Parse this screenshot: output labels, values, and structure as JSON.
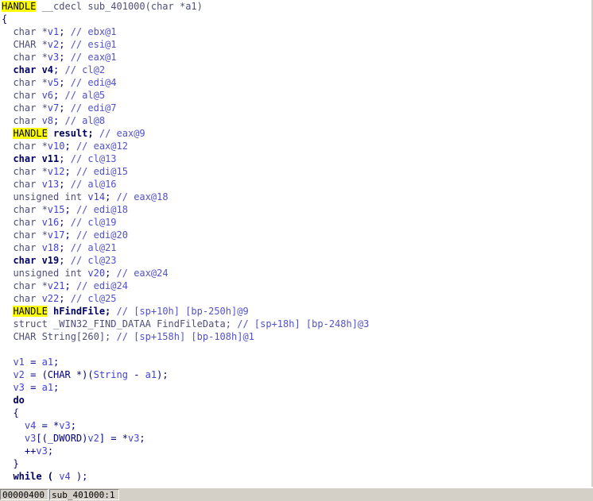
{
  "code_lines": [
    [
      [
        "HANDLE",
        "cursor"
      ],
      [
        " __cdecl sub_401000(char *a1)",
        "muted"
      ]
    ],
    [
      [
        "{",
        "default"
      ]
    ],
    [
      [
        "  char *",
        "muted"
      ],
      [
        "v1",
        "var"
      ],
      [
        "; ",
        "default"
      ],
      [
        "// ebx@1",
        "comment"
      ]
    ],
    [
      [
        "  CHAR *",
        "muted"
      ],
      [
        "v2",
        "var"
      ],
      [
        "; ",
        "default"
      ],
      [
        "// esi@1",
        "comment"
      ]
    ],
    [
      [
        "  char *",
        "muted"
      ],
      [
        "v3",
        "var"
      ],
      [
        "; ",
        "default"
      ],
      [
        "// eax@1",
        "comment"
      ]
    ],
    [
      [
        "  char ",
        "kw"
      ],
      [
        "v4",
        "kw"
      ],
      [
        "; ",
        "default"
      ],
      [
        "// cl@2",
        "comment"
      ]
    ],
    [
      [
        "  char *",
        "muted"
      ],
      [
        "v5",
        "var"
      ],
      [
        "; ",
        "default"
      ],
      [
        "// edi@4",
        "comment"
      ]
    ],
    [
      [
        "  char ",
        "muted"
      ],
      [
        "v6",
        "var"
      ],
      [
        "; ",
        "default"
      ],
      [
        "// al@5",
        "comment"
      ]
    ],
    [
      [
        "  char *",
        "muted"
      ],
      [
        "v7",
        "var"
      ],
      [
        "; ",
        "default"
      ],
      [
        "// edi@7",
        "comment"
      ]
    ],
    [
      [
        "  char ",
        "muted"
      ],
      [
        "v8",
        "var"
      ],
      [
        "; ",
        "default"
      ],
      [
        "// al@8",
        "comment"
      ]
    ],
    [
      [
        "  ",
        "default"
      ],
      [
        "HANDLE",
        "hl"
      ],
      [
        " result; ",
        "kw"
      ],
      [
        "// eax@9",
        "comment"
      ]
    ],
    [
      [
        "  char *",
        "muted"
      ],
      [
        "v10",
        "var"
      ],
      [
        "; ",
        "default"
      ],
      [
        "// eax@12",
        "comment"
      ]
    ],
    [
      [
        "  char ",
        "kw"
      ],
      [
        "v11",
        "kw"
      ],
      [
        "; ",
        "default"
      ],
      [
        "// cl@13",
        "comment"
      ]
    ],
    [
      [
        "  char *",
        "muted"
      ],
      [
        "v12",
        "var"
      ],
      [
        "; ",
        "default"
      ],
      [
        "// edi@15",
        "comment"
      ]
    ],
    [
      [
        "  char ",
        "muted"
      ],
      [
        "v13",
        "var"
      ],
      [
        "; ",
        "default"
      ],
      [
        "// al@16",
        "comment"
      ]
    ],
    [
      [
        "  unsigned int ",
        "muted"
      ],
      [
        "v14",
        "var"
      ],
      [
        "; ",
        "default"
      ],
      [
        "// eax@18",
        "comment"
      ]
    ],
    [
      [
        "  char *",
        "muted"
      ],
      [
        "v15",
        "var"
      ],
      [
        "; ",
        "default"
      ],
      [
        "// edi@18",
        "comment"
      ]
    ],
    [
      [
        "  char ",
        "muted"
      ],
      [
        "v16",
        "var"
      ],
      [
        "; ",
        "default"
      ],
      [
        "// cl@19",
        "comment"
      ]
    ],
    [
      [
        "  char *",
        "muted"
      ],
      [
        "v17",
        "var"
      ],
      [
        "; ",
        "default"
      ],
      [
        "// edi@20",
        "comment"
      ]
    ],
    [
      [
        "  char ",
        "muted"
      ],
      [
        "v18",
        "var"
      ],
      [
        "; ",
        "default"
      ],
      [
        "// al@21",
        "comment"
      ]
    ],
    [
      [
        "  char ",
        "kw"
      ],
      [
        "v19",
        "kw"
      ],
      [
        "; ",
        "default"
      ],
      [
        "// cl@23",
        "comment"
      ]
    ],
    [
      [
        "  unsigned int ",
        "muted"
      ],
      [
        "v20",
        "var"
      ],
      [
        "; ",
        "default"
      ],
      [
        "// eax@24",
        "comment"
      ]
    ],
    [
      [
        "  char *",
        "muted"
      ],
      [
        "v21",
        "var"
      ],
      [
        "; ",
        "default"
      ],
      [
        "// edi@24",
        "comment"
      ]
    ],
    [
      [
        "  char ",
        "muted"
      ],
      [
        "v22",
        "var"
      ],
      [
        "; ",
        "default"
      ],
      [
        "// cl@25",
        "comment"
      ]
    ],
    [
      [
        "  ",
        "default"
      ],
      [
        "HANDLE",
        "hl"
      ],
      [
        " hFindFile; ",
        "kw"
      ],
      [
        "// [sp+10h] [bp-250h]@9",
        "comment"
      ]
    ],
    [
      [
        "  struct _WIN32_FIND_DATAA FindFileData; ",
        "muted"
      ],
      [
        "// [sp+18h] [bp-248h]@3",
        "comment"
      ]
    ],
    [
      [
        "  CHAR String[260]; ",
        "muted"
      ],
      [
        "// [sp+158h] [bp-108h]@1",
        "comment"
      ]
    ],
    [
      [
        "",
        "default"
      ]
    ],
    [
      [
        "  ",
        "default"
      ],
      [
        "v1",
        "var"
      ],
      [
        " = ",
        "default"
      ],
      [
        "a1",
        "var"
      ],
      [
        ";",
        "default"
      ]
    ],
    [
      [
        "  ",
        "default"
      ],
      [
        "v2",
        "var"
      ],
      [
        " = (CHAR *)(",
        "default"
      ],
      [
        "String",
        "var"
      ],
      [
        " - ",
        "default"
      ],
      [
        "a1",
        "var"
      ],
      [
        ");",
        "default"
      ]
    ],
    [
      [
        "  ",
        "default"
      ],
      [
        "v3",
        "var"
      ],
      [
        " = ",
        "default"
      ],
      [
        "a1",
        "var"
      ],
      [
        ";",
        "default"
      ]
    ],
    [
      [
        "  do",
        "kw"
      ]
    ],
    [
      [
        "  {",
        "default"
      ]
    ],
    [
      [
        "    ",
        "default"
      ],
      [
        "v4",
        "var"
      ],
      [
        " = *",
        "default"
      ],
      [
        "v3",
        "var"
      ],
      [
        ";",
        "default"
      ]
    ],
    [
      [
        "    ",
        "default"
      ],
      [
        "v3",
        "var"
      ],
      [
        "[(_DWORD)",
        "default"
      ],
      [
        "v2",
        "var"
      ],
      [
        "] = *",
        "default"
      ],
      [
        "v3",
        "var"
      ],
      [
        ";",
        "default"
      ]
    ],
    [
      [
        "    ++",
        "default"
      ],
      [
        "v3",
        "var"
      ],
      [
        ";",
        "default"
      ]
    ],
    [
      [
        "  }",
        "default"
      ]
    ],
    [
      [
        "  while ( ",
        "kw"
      ],
      [
        "v4",
        "var"
      ],
      [
        " );",
        "default"
      ]
    ]
  ],
  "status": {
    "address": "00000400",
    "function": "sub_401000:1"
  }
}
